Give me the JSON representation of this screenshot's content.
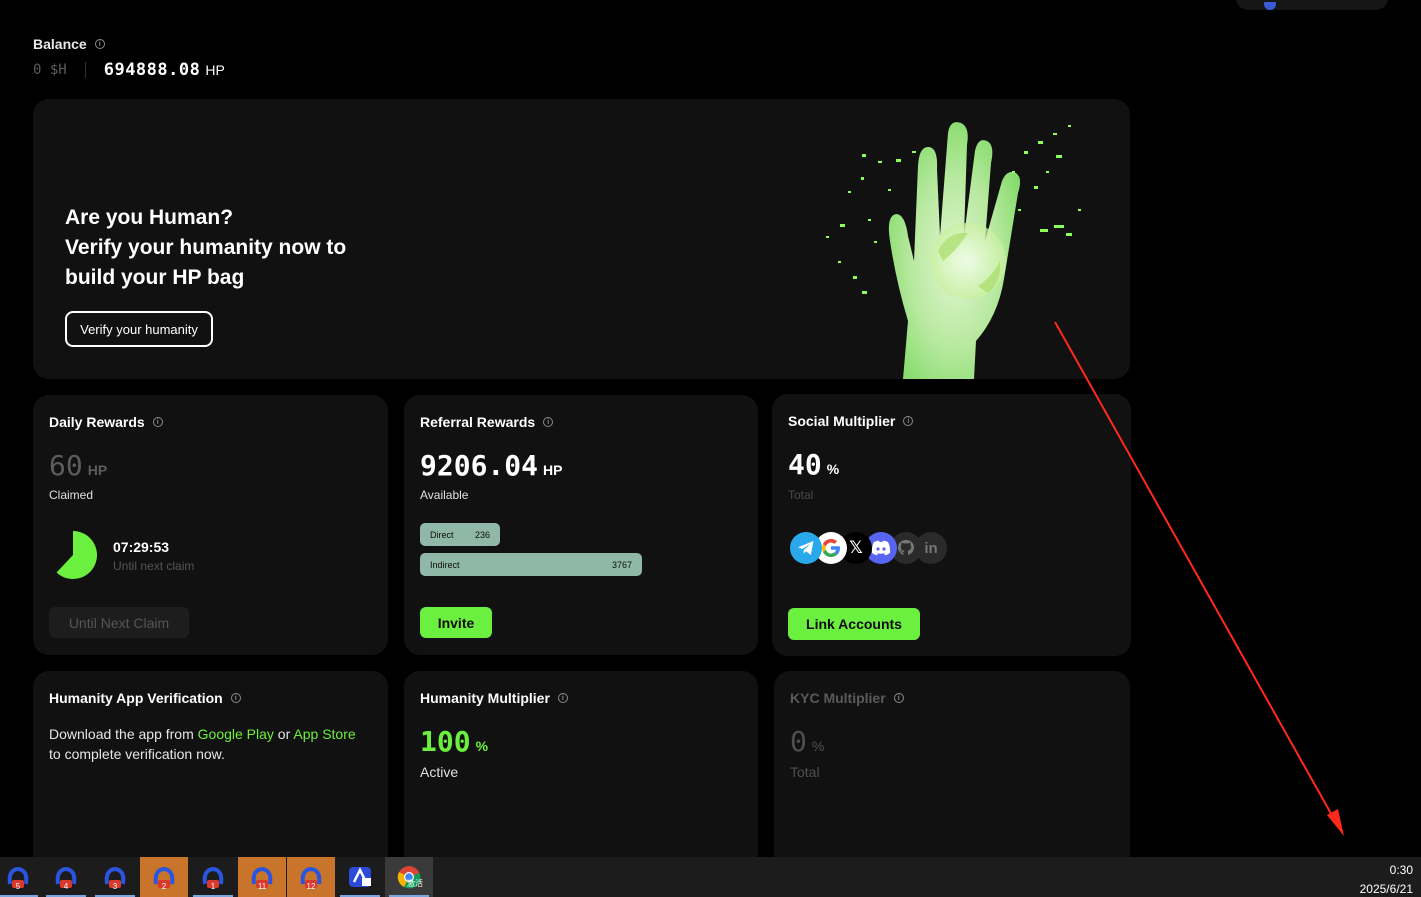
{
  "balance": {
    "label": "Balance",
    "sh": "0 $H",
    "hp_value": "694888.08",
    "hp_unit": "HP"
  },
  "hero": {
    "line1": "Are you Human?",
    "line2": "Verify your humanity now to",
    "line3": "build your HP bag",
    "button": "Verify your humanity"
  },
  "daily": {
    "title": "Daily Rewards",
    "value": "60",
    "unit": "HP",
    "status": "Claimed",
    "timer": "07:29:53",
    "timer_label": "Until next claim",
    "button": "Until Next Claim",
    "progress": 0.62
  },
  "referral": {
    "title": "Referral Rewards",
    "value": "9206.04",
    "unit": "HP",
    "status": "Available",
    "direct_label": "Direct",
    "direct_value": "236",
    "indirect_label": "Indirect",
    "indirect_value": "3767",
    "button": "Invite"
  },
  "social": {
    "title": "Social Multiplier",
    "value": "40",
    "unit": "%",
    "status": "Total",
    "icons": [
      "telegram-icon",
      "google-icon",
      "x-icon",
      "discord-icon",
      "github-icon",
      "linkedin-icon"
    ],
    "x_glyph": "𝕏",
    "linkedin_glyph": "in",
    "button": "Link Accounts"
  },
  "humanity_app": {
    "title": "Humanity App Verification",
    "text_before": "Download the app from ",
    "google_play": "Google Play",
    "text_or": " or ",
    "app_store": "App Store",
    "text_after": " to complete verification now."
  },
  "humanity_mult": {
    "title": "Humanity Multiplier",
    "value": "100",
    "unit": "%",
    "status": "Active"
  },
  "kyc": {
    "title": "KYC Multiplier",
    "value": "0",
    "unit": "%",
    "status": "Total"
  },
  "taskbar": {
    "items": [
      "5",
      "4",
      "3",
      "2",
      "1",
      "11",
      "12"
    ],
    "chrome_badge": "激活",
    "time": "0:30",
    "date": "2025/6/21"
  },
  "colors": {
    "accent_green": "#6cf03f",
    "card_bg": "#111111",
    "arrow_red": "#ff2a1a"
  }
}
